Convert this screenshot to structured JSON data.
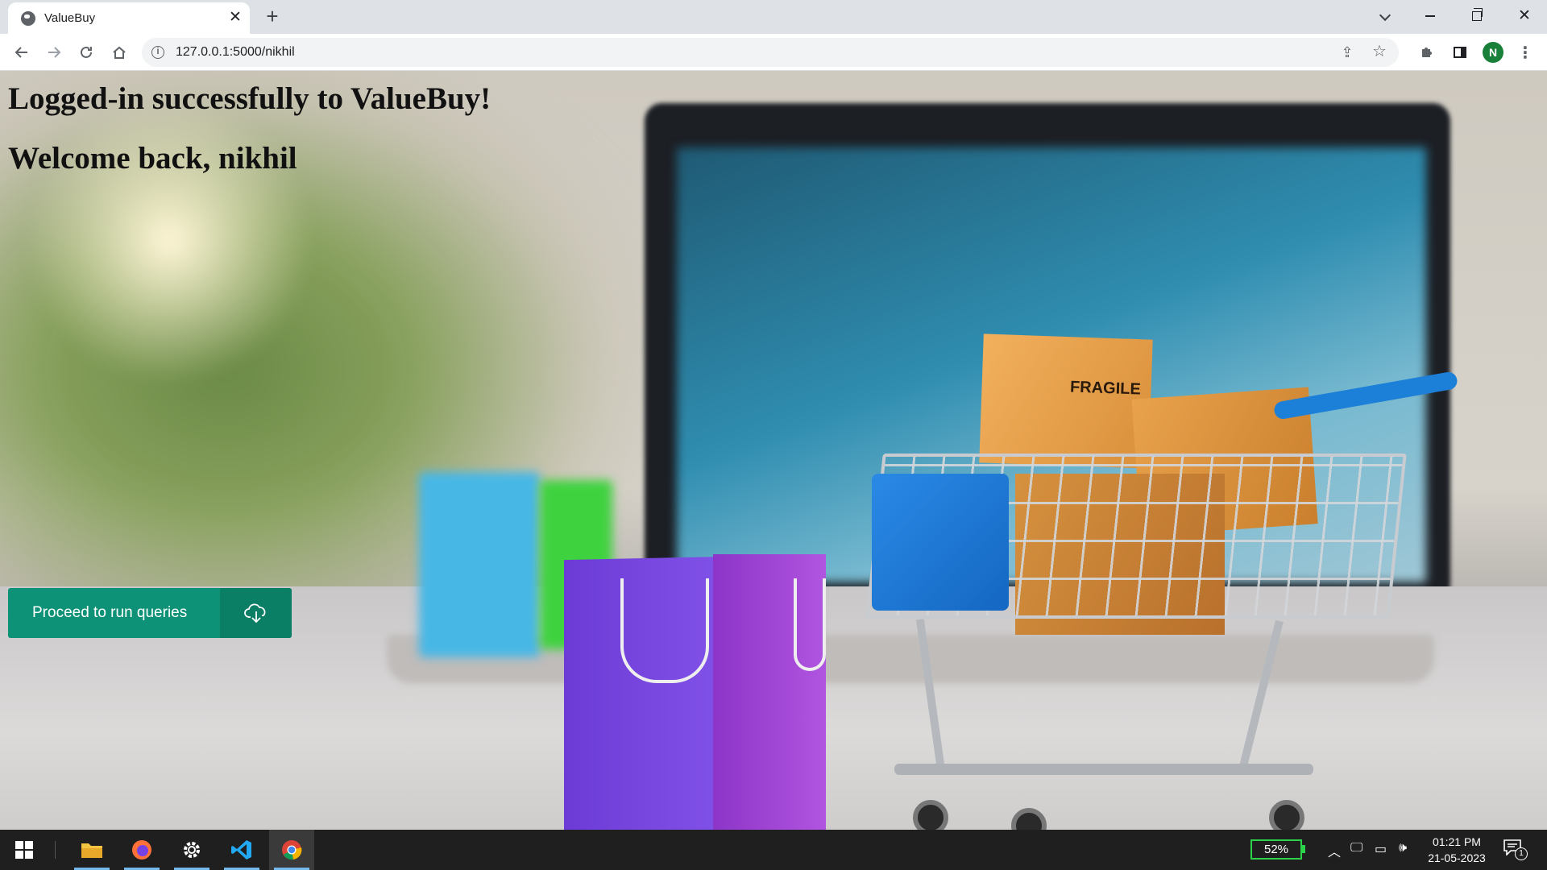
{
  "browser": {
    "tab_title": "ValueBuy",
    "url": "127.0.0.1:5000/nikhil",
    "profile_initial": "N",
    "profile_color": "#188038"
  },
  "page": {
    "login_message": "Logged-in successfully to ValueBuy!",
    "welcome_message": "Welcome back, nikhil",
    "cta_label": "Proceed to run queries",
    "cta_icon": "cloud-download-icon",
    "cta_color": "#0e9277"
  },
  "taskbar": {
    "apps": [
      "start-icon",
      "file-explorer-icon",
      "firefox-icon",
      "settings-icon",
      "vscode-icon",
      "chrome-icon"
    ],
    "active_app": "chrome-icon",
    "battery_percent": "52%",
    "time": "01:21 PM",
    "date": "21-05-2023",
    "notification_count": "1"
  }
}
